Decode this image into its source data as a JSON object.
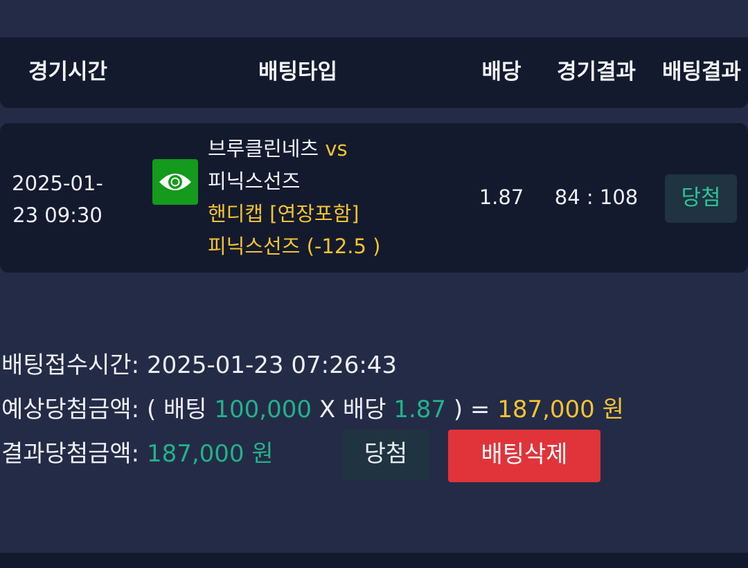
{
  "table_header": {
    "columns": [
      "경기시간",
      "배팅타입",
      "배당",
      "경기결과",
      "배팅결과"
    ]
  },
  "bet_row": {
    "datetime_line1": "2025-01-",
    "datetime_line2": "23 09:30",
    "view_icon": "eye-icon",
    "home_team": "브루클린네츠",
    "vs": "vs",
    "away_team": "피닉스선즈",
    "market": "핸디캡 [연장포함]",
    "selection": "피닉스선즈 (-12.5 )",
    "odds": "1.87",
    "score": "84 : 108",
    "result": "당첨"
  },
  "summary": {
    "received_label": "배팅접수시간:",
    "received_value": "2025-01-23 07:26:43",
    "expected_label": "예상당첨금액:",
    "expected_open": "( 배팅",
    "stake": "100,000",
    "times": "X 배당",
    "odds": "1.87",
    "equals": ") =",
    "expected_amount": "187,000 원",
    "result_label": "결과당첨금액:",
    "result_amount": "187,000 원",
    "win_button": "당첨",
    "delete_button": "배팅삭제"
  },
  "colors": {
    "background": "#242b47",
    "panel": "#141a2e",
    "accent_yellow": "#f3c431",
    "accent_teal": "#22b28b",
    "danger": "#e0343a",
    "icon_green": "#149a1c"
  }
}
